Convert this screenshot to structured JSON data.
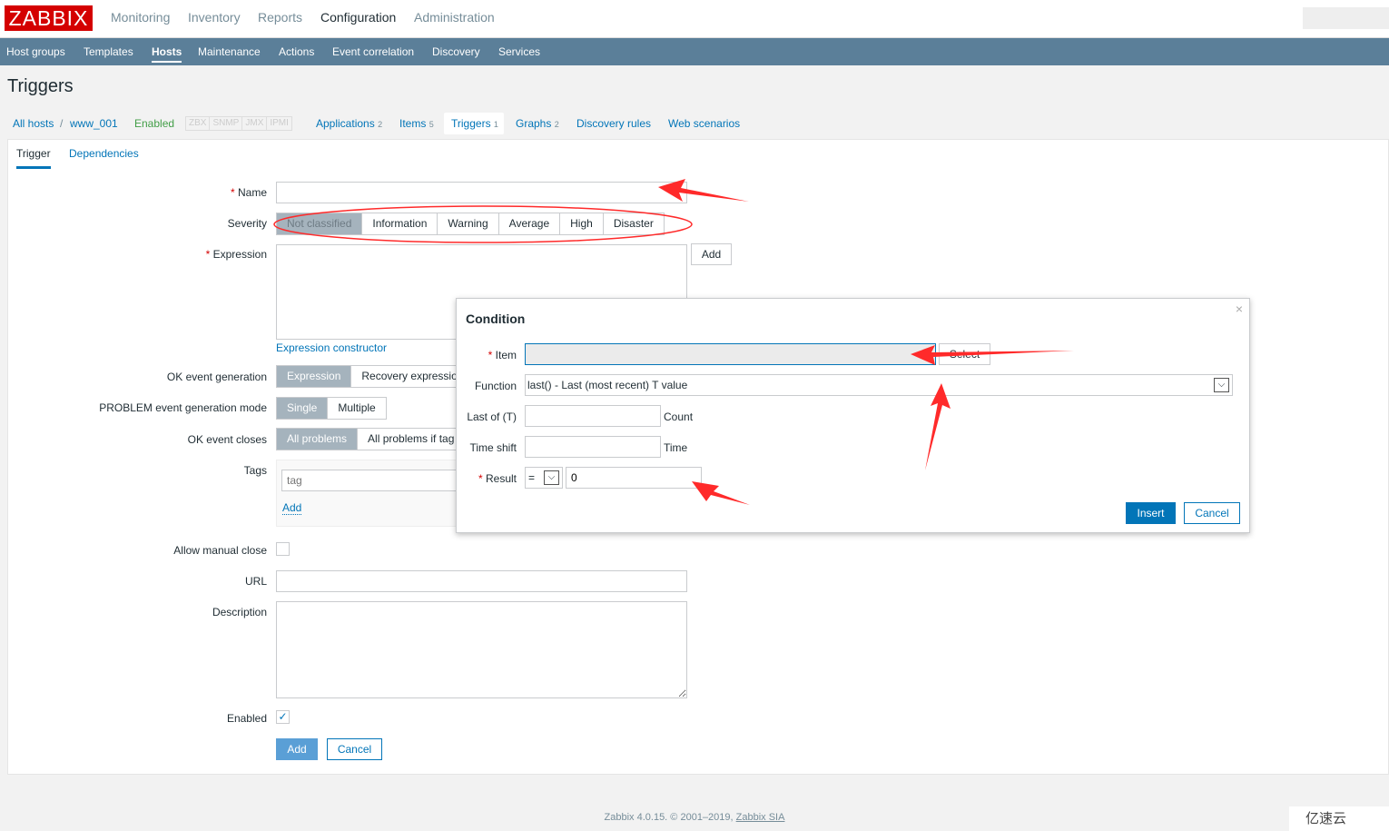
{
  "logo": "ZABBIX",
  "main_menu": [
    "Monitoring",
    "Inventory",
    "Reports",
    "Configuration",
    "Administration"
  ],
  "sub_menu": [
    "Host groups",
    "Templates",
    "Hosts",
    "Maintenance",
    "Actions",
    "Event correlation",
    "Discovery",
    "Services"
  ],
  "page_title": "Triggers",
  "breadcrumb": {
    "all_hosts": "All hosts",
    "sep": "/",
    "host": "www_001",
    "status": "Enabled",
    "availability": [
      "ZBX",
      "SNMP",
      "JMX",
      "IPMI"
    ],
    "links": [
      {
        "label": "Applications",
        "count": "2"
      },
      {
        "label": "Items",
        "count": "5"
      },
      {
        "label": "Triggers",
        "count": "1"
      },
      {
        "label": "Graphs",
        "count": "2"
      },
      {
        "label": "Discovery rules",
        "count": ""
      },
      {
        "label": "Web scenarios",
        "count": ""
      }
    ]
  },
  "tabs": [
    "Trigger",
    "Dependencies"
  ],
  "form": {
    "name_label": "Name",
    "severity_label": "Severity",
    "severities": [
      "Not classified",
      "Information",
      "Warning",
      "Average",
      "High",
      "Disaster"
    ],
    "expression_label": "Expression",
    "add_label": "Add",
    "expression_constructor": "Expression constructor",
    "ok_event_label": "OK event generation",
    "ok_event_options": [
      "Expression",
      "Recovery expression"
    ],
    "problem_mode_label": "PROBLEM event generation mode",
    "problem_mode_options": [
      "Single",
      "Multiple"
    ],
    "ok_closes_label": "OK event closes",
    "ok_closes_options": [
      "All problems",
      "All problems if tag"
    ],
    "tags_label": "Tags",
    "tag_placeholder": "tag",
    "tags_add": "Add",
    "manual_close_label": "Allow manual close",
    "url_label": "URL",
    "description_label": "Description",
    "enabled_label": "Enabled",
    "enabled": true,
    "submit": "Add",
    "cancel": "Cancel"
  },
  "dialog": {
    "title": "Condition",
    "close": "×",
    "item_label": "Item",
    "item_value": "",
    "select": "Select",
    "function_label": "Function",
    "function_value": "last() - Last (most recent) T value",
    "last_of_label": "Last of (T)",
    "last_of_unit": "Count",
    "time_shift_label": "Time shift",
    "time_shift_unit": "Time",
    "result_label": "Result",
    "result_op": "=",
    "result_value": "0",
    "insert": "Insert",
    "cancel": "Cancel"
  },
  "footer": {
    "text": "Zabbix 4.0.15. © 2001–2019, ",
    "link": "Zabbix SIA"
  },
  "watermark": "亿速云",
  "colors": {
    "brand": "#d40000",
    "nav": "#5b7f99",
    "link": "#0275b8",
    "primary": "#0275b8",
    "annotation": "#ff2a2a"
  }
}
